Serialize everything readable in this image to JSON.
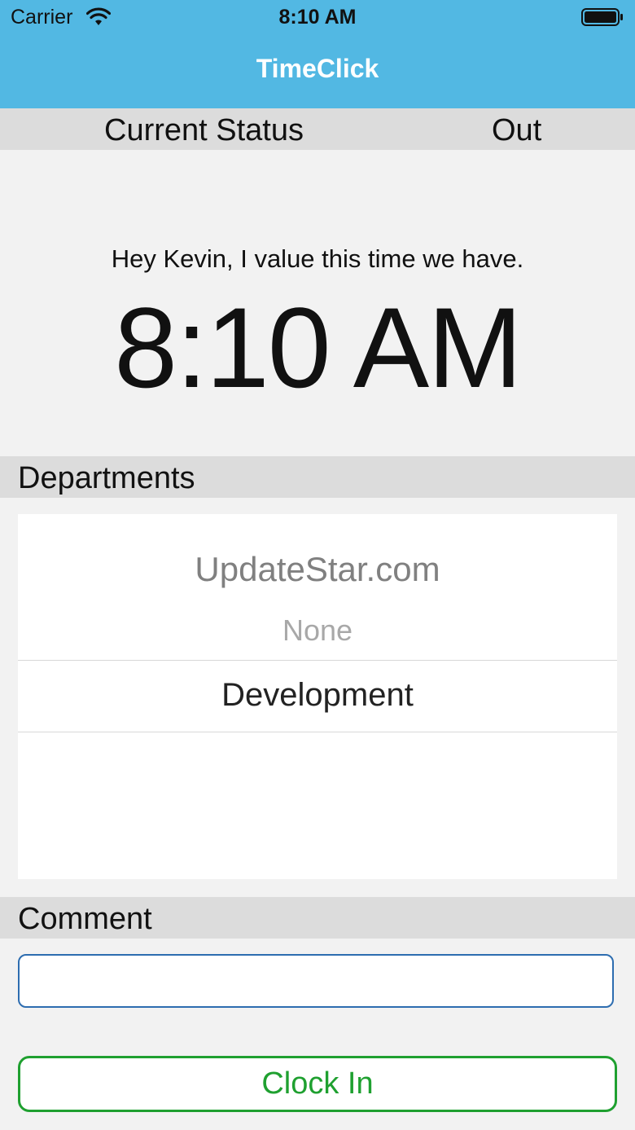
{
  "status_bar": {
    "carrier": "Carrier",
    "time": "8:10 AM",
    "icons": [
      "wifi-icon",
      "battery-icon"
    ]
  },
  "nav": {
    "title": "TimeClick",
    "color": "#52b8e3"
  },
  "status": {
    "label": "Current Status",
    "value": "Out"
  },
  "greeting": "Hey Kevin, I value this time we have.",
  "current_time": "8:10 AM",
  "departments": {
    "header": "Departments",
    "watermark": "UpdateStar.com",
    "options": [
      "None",
      "Development"
    ],
    "selected": "Development"
  },
  "comment": {
    "header": "Comment",
    "value": "",
    "placeholder": ""
  },
  "actions": {
    "clock_in_label": "Clock In",
    "color": "#1fa030"
  }
}
